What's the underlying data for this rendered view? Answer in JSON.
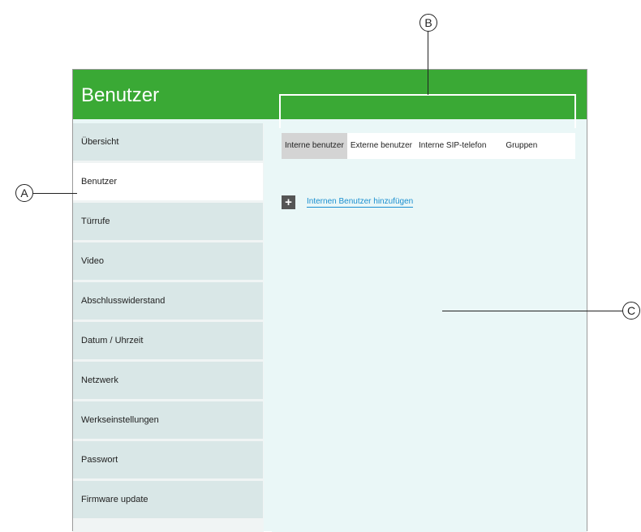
{
  "header": {
    "title": "Benutzer"
  },
  "sidebar": {
    "items": [
      {
        "label": "Übersicht"
      },
      {
        "label": "Benutzer"
      },
      {
        "label": "Türrufe"
      },
      {
        "label": "Video"
      },
      {
        "label": "Abschlusswiderstand"
      },
      {
        "label": "Datum / Uhrzeit"
      },
      {
        "label": "Netzwerk"
      },
      {
        "label": "Werkseinstellungen"
      },
      {
        "label": "Passwort"
      },
      {
        "label": "Firmware update"
      }
    ],
    "active_index": 1
  },
  "tabs": [
    {
      "label": "Interne benutzer"
    },
    {
      "label": "Externe benutzer"
    },
    {
      "label": "Interne SIP-telefon"
    },
    {
      "label": "Gruppen"
    }
  ],
  "main": {
    "add_icon": "plus-icon",
    "add_link": "Internen Benutzer hinzufügen"
  },
  "callouts": {
    "a": "A",
    "b": "B",
    "c": "C"
  },
  "colors": {
    "header": "#3aa935",
    "link": "#1a8fd0",
    "active_tab": "#d4d4d4"
  }
}
